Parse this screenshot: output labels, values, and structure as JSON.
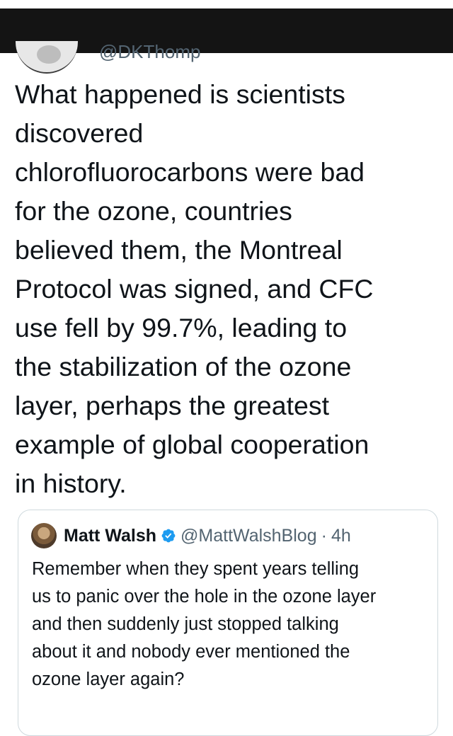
{
  "tweet": {
    "author_handle_partial": "@DKThomp",
    "text": "What happened is scientists\ndiscovered\nchlorofluorocarbons were bad\nfor the ozone, countries\nbelieved them, the Montreal\nProtocol was signed, and CFC\nuse fell by 99.7%, leading to\nthe stabilization of the ozone\nlayer, perhaps the greatest\nexample of global cooperation\nin history."
  },
  "quoted_tweet": {
    "author_name": "Matt Walsh",
    "verified": true,
    "handle": "@MattWalshBlog",
    "separator": "·",
    "time": "4h",
    "text": "Remember when they spent years telling\nus to panic over the hole in the ozone layer\nand then suddenly just stopped talking\nabout it and nobody ever mentioned the\nozone layer again?"
  },
  "colors": {
    "text": "#0f1419",
    "secondary_text": "#536471",
    "verified_badge": "#1d9bf0",
    "card_border": "#cfd9de",
    "redaction": "#141414"
  },
  "icons": {
    "verified": "verified-badge-icon"
  }
}
